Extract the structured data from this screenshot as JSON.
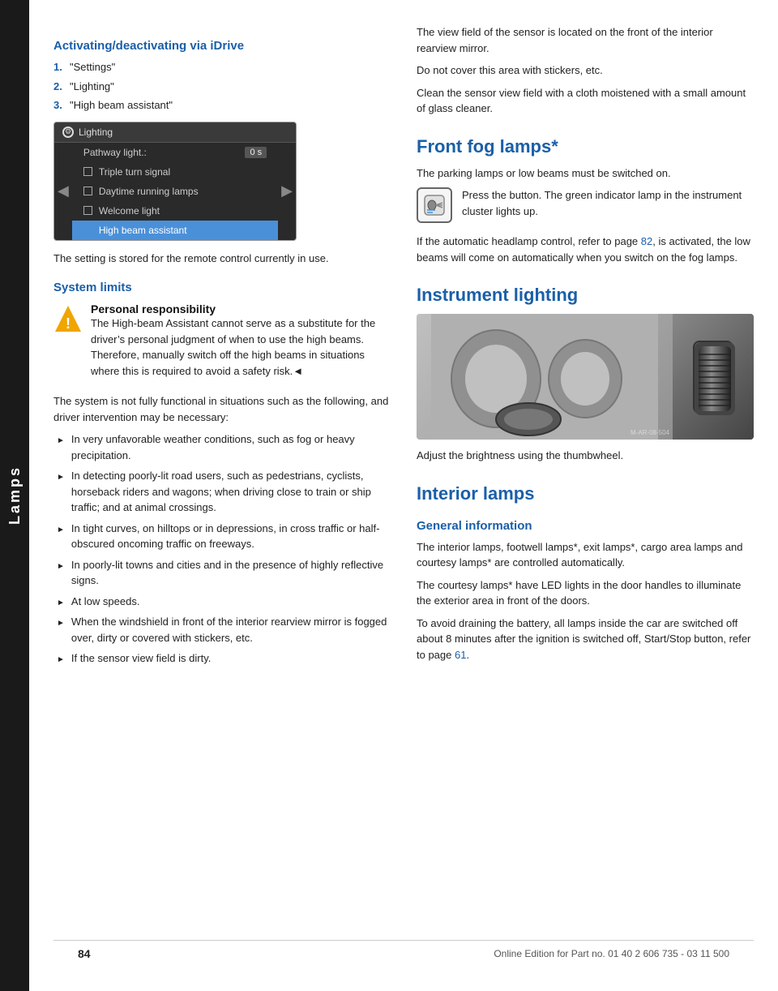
{
  "sidebar": {
    "label": "Lamps"
  },
  "left_col": {
    "section1_heading": "Activating/deactivating via iDrive",
    "steps": [
      {
        "num": "1.",
        "text": "\"Settings\""
      },
      {
        "num": "2.",
        "text": "\"Lighting\""
      },
      {
        "num": "3.",
        "text": "\"High beam assistant\""
      }
    ],
    "idrive": {
      "title": "Lighting",
      "items": [
        {
          "label": "Pathway light.:",
          "value": "0 s",
          "type": "value",
          "checked": false
        },
        {
          "label": "Triple turn signal",
          "value": "",
          "type": "checkbox",
          "checked": false
        },
        {
          "label": "Daytime running lamps",
          "value": "",
          "type": "checkbox",
          "checked": false
        },
        {
          "label": "Welcome light",
          "value": "",
          "type": "checkbox",
          "checked": false
        },
        {
          "label": "High beam assistant",
          "value": "",
          "type": "checkbox",
          "checked": true,
          "highlighted": true
        }
      ]
    },
    "stored_setting_text": "The setting is stored for the remote control currently in use.",
    "system_limits_heading": "System limits",
    "warning_heading": "Personal responsibility",
    "warning_text": "The High-beam Assistant cannot serve as a substitute for the driver’s personal judgment of when to use the high beams. Therefore, manually switch off the high beams in situations where this is required to avoid a safety risk.◄",
    "system_text1": "The system is not fully functional in situations such as the following, and driver intervention may be necessary:",
    "bullets": [
      "In very unfavorable weather conditions, such as fog or heavy precipitation.",
      "In detecting poorly-lit road users, such as pedestrians, cyclists, horseback riders and wagons; when driving close to train or ship traffic; and at animal crossings.",
      "In tight curves, on hilltops or in depressions, in cross traffic or half-obscured oncoming traffic on freeways.",
      "In poorly-lit towns and cities and in the presence of highly reflective signs.",
      "At low speeds.",
      "When the windshield in front of the interior rearview mirror is fogged over, dirty or covered with stickers, etc.",
      "If the sensor view field is dirty."
    ]
  },
  "right_col": {
    "sensor_text1": "The view field of the sensor is located on the front of the interior rearview mirror.",
    "sensor_text2": "Do not cover this area with stickers, etc.",
    "sensor_text3": "Clean the sensor view field with a cloth moistened with a small amount of glass cleaner.",
    "front_fog_heading": "Front fog lamps*",
    "front_fog_text1": "The parking lamps or low beams must be switched on.",
    "front_fog_icon_label": "fog lamp icon",
    "front_fog_press_text": "Press the button. The green indicator lamp in the instrument cluster lights up.",
    "front_fog_text2": "If the automatic headlamp control, refer to page 82, is activated, the low beams will come on automatically when you switch on the fog lamps.",
    "front_fog_page_ref": "82",
    "instrument_heading": "Instrument lighting",
    "instrument_text": "Adjust the brightness using the thumbwheel.",
    "interior_heading": "Interior lamps",
    "general_info_heading": "General information",
    "general_info_text1": "The interior lamps, footwell lamps*, exit lamps*, cargo area lamps and courtesy lamps* are controlled automatically.",
    "general_info_text2": "The courtesy lamps* have LED lights in the door handles to illuminate the exterior area in front of the doors.",
    "general_info_text3": "To avoid draining the battery, all lamps inside the car are switched off about 8 minutes after the ignition is switched off, Start/Stop button, refer to page 61.",
    "general_info_page_ref": "61"
  },
  "footer": {
    "page_number": "84",
    "edition_text": "Online Edition for Part no. 01 40 2 606 735 - 03 11 500"
  }
}
